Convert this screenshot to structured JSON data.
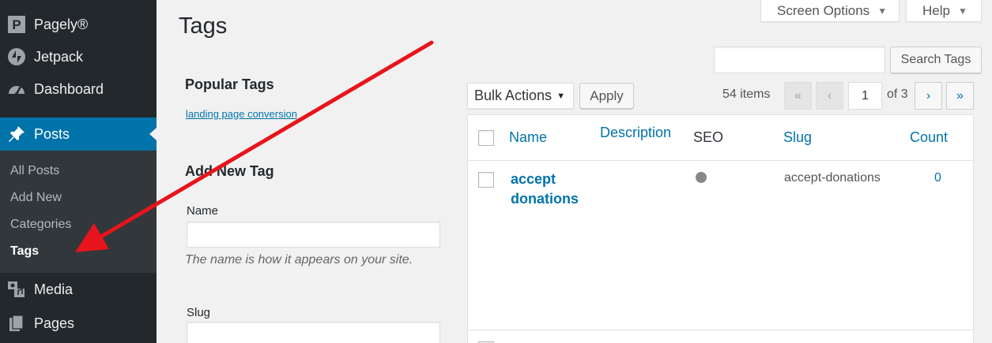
{
  "sidebar": {
    "items": [
      {
        "label": "Pagely®",
        "icon": "pagely-logo-icon"
      },
      {
        "label": "Jetpack",
        "icon": "jetpack-icon"
      },
      {
        "label": "Dashboard",
        "icon": "dashboard-icon"
      },
      {
        "label": "Posts",
        "icon": "pin-icon",
        "active": true
      },
      {
        "label": "Media",
        "icon": "media-icon"
      },
      {
        "label": "Pages",
        "icon": "pages-icon"
      }
    ],
    "submenu": [
      {
        "label": "All Posts"
      },
      {
        "label": "Add New"
      },
      {
        "label": "Categories"
      },
      {
        "label": "Tags",
        "current": true
      }
    ]
  },
  "header": {
    "screen_options": "Screen Options",
    "help": "Help",
    "title": "Tags"
  },
  "search": {
    "value": "",
    "button": "Search Tags"
  },
  "popular": {
    "heading": "Popular Tags",
    "tags": [
      "landing page conversion"
    ]
  },
  "add_new": {
    "heading": "Add New Tag",
    "name_label": "Name",
    "name_value": "",
    "name_description": "The name is how it appears on your site.",
    "slug_label": "Slug",
    "slug_value": ""
  },
  "tablenav": {
    "bulk_actions": "Bulk Actions",
    "apply": "Apply",
    "items_count": "54 items",
    "first": "«",
    "prev": "‹",
    "current_page": "1",
    "of_pages": "of 3",
    "next": "›",
    "last": "»"
  },
  "table": {
    "columns": [
      "Name",
      "Description",
      "SEO",
      "Slug",
      "Count"
    ],
    "rows": [
      {
        "name": "accept donations",
        "description": "",
        "seo": "grey-dot",
        "slug": "accept-donations",
        "count": "0"
      }
    ]
  },
  "colors": {
    "sidebar_bg": "#23282d",
    "active": "#0073aa",
    "annotation_arrow": "#e8141b"
  }
}
